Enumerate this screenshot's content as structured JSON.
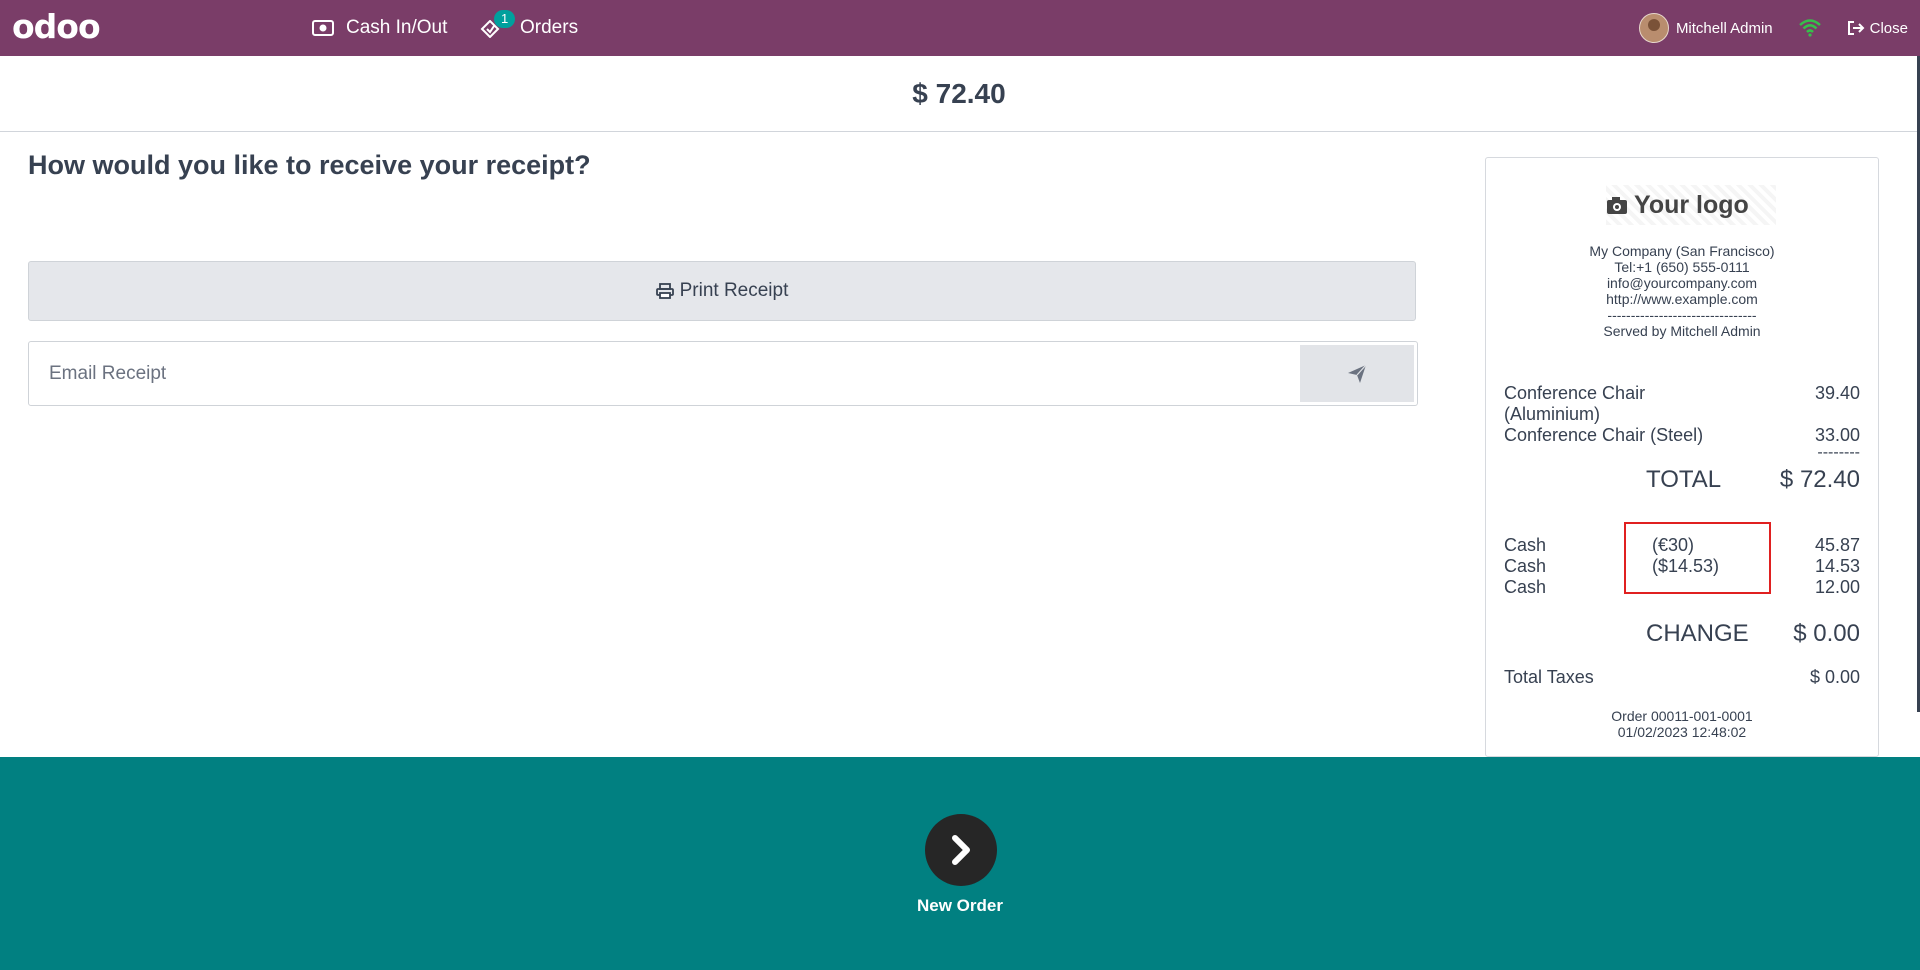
{
  "navbar": {
    "logo": "odoo",
    "cash_label": "Cash In/Out",
    "orders_label": "Orders",
    "orders_badge": "1",
    "user_name": "Mitchell Admin",
    "close_label": "Close"
  },
  "header": {
    "amount": "$ 72.40"
  },
  "receipt_options": {
    "question": "How would you like to receive your receipt?",
    "print_label": "Print Receipt",
    "email_placeholder": "Email Receipt"
  },
  "receipt": {
    "logo_text": "Your logo",
    "company_lines": [
      "My Company (San Francisco)",
      "Tel:+1 (650) 555-0111",
      "info@yourcompany.com",
      "http://www.example.com",
      "--------------------------------",
      "Served by Mitchell Admin"
    ],
    "lines": [
      {
        "name1": "Conference Chair",
        "name2": "(Aluminium)",
        "price": "39.40"
      },
      {
        "name1": "Conference Chair (Steel)",
        "price": "33.00"
      }
    ],
    "separator": "--------",
    "total_label": "TOTAL",
    "total_value": "$ 72.40",
    "payments": [
      {
        "method": "Cash",
        "detail": "(€30)",
        "amount": "45.87"
      },
      {
        "method": "Cash",
        "detail": "($14.53)",
        "amount": "14.53"
      },
      {
        "method": "Cash",
        "detail": "",
        "amount": "12.00"
      }
    ],
    "change_label": "CHANGE",
    "change_value": "$ 0.00",
    "taxes_label": "Total Taxes",
    "taxes_value": "$ 0.00",
    "order_ref": "Order 00011-001-0001",
    "order_date": "01/02/2023 12:48:02"
  },
  "footer": {
    "next_label": "New Order"
  },
  "colors": {
    "navbar": "#7a3d68",
    "footer": "#018081",
    "highlight": "#e02020",
    "badge": "#00a09d"
  }
}
